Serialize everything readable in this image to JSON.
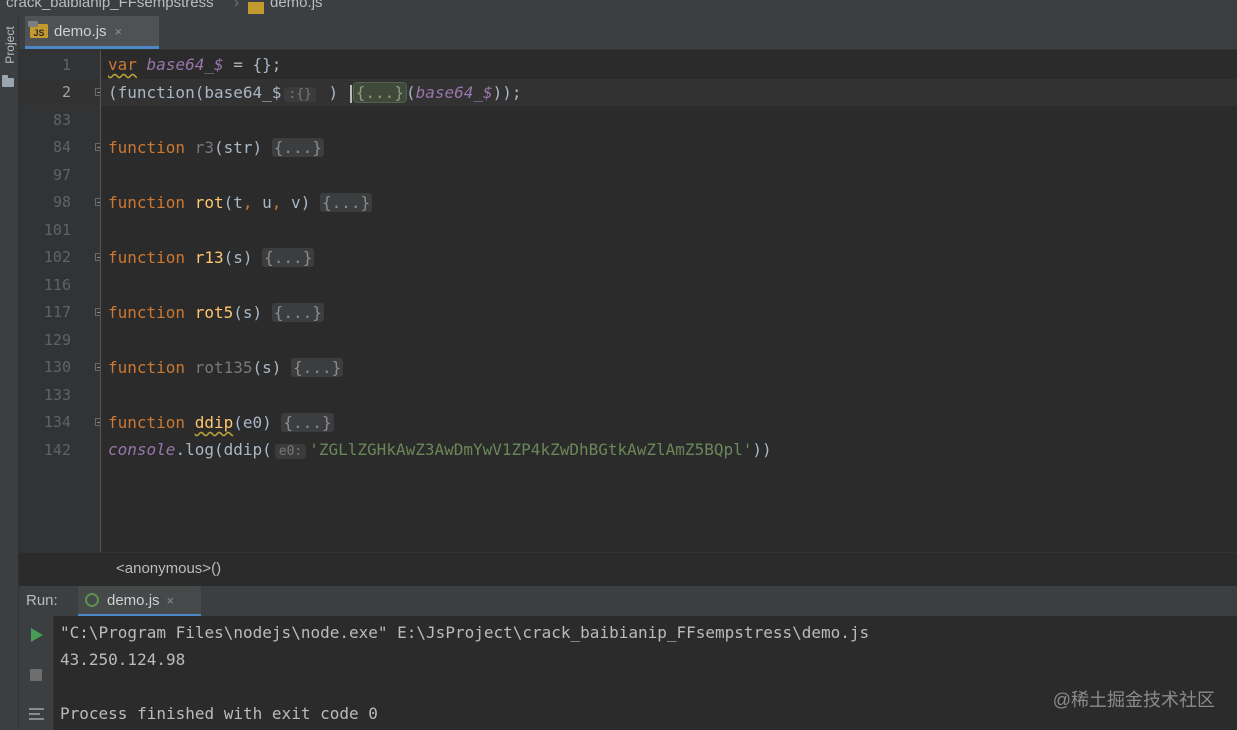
{
  "breadcrumb": {
    "project": "crack_baibianip_FFsempstress",
    "file": "demo.js"
  },
  "sidebar": {
    "project_label": "Project"
  },
  "editor_tab": {
    "label": "demo.js",
    "close": "×",
    "icon": "js-file-icon"
  },
  "editor": {
    "line_numbers": [
      "1",
      "2",
      "83",
      "84",
      "97",
      "98",
      "101",
      "102",
      "116",
      "117",
      "129",
      "130",
      "133",
      "134",
      "142"
    ],
    "line1": {
      "var": "var",
      "name": "base64_$",
      "rest": " = {};"
    },
    "line2": {
      "open": "(function(base64_$",
      "hint": ":{}",
      "mid": " ) ",
      "fold": "{...}",
      "paren": "(",
      "arg": "base64_$",
      "close": "));"
    },
    "functions": [
      {
        "kw": "function",
        "name": "r3",
        "params": "(str)",
        "fold": "{...}",
        "used": false
      },
      {
        "kw": "function",
        "name": "rot",
        "params_open": "(t",
        "comma1": ",",
        "u": " u",
        "comma2": ",",
        "v": " v)",
        "fold": "{...}",
        "used": true
      },
      {
        "kw": "function",
        "name": "r13",
        "params": "(s)",
        "fold": "{...}",
        "used": true
      },
      {
        "kw": "function",
        "name": "rot5",
        "params": "(s)",
        "fold": "{...}",
        "used": true
      },
      {
        "kw": "function",
        "name": "rot135",
        "params": "(s)",
        "fold": "{...}",
        "used": false
      },
      {
        "kw": "function",
        "name": "ddip",
        "params": "(e0)",
        "fold": "{...}",
        "used": true
      }
    ],
    "last_line": {
      "obj": "console",
      "dot": ".log(ddip(",
      "hint": "e0:",
      "arg": "'ZGLlZGHkAwZ3AwDmYwV1ZP4kZwDhBGtkAwZlAmZ5BQpl'",
      "close": "))"
    }
  },
  "editor_status": {
    "text": "<anonymous>()"
  },
  "run_panel": {
    "title": "Run:",
    "tab_label": "demo.js",
    "tab_close": "×",
    "output": [
      "\"C:\\Program Files\\nodejs\\node.exe\" E:\\JsProject\\crack_baibianip_FFsempstress\\demo.js",
      "43.250.124.98",
      "",
      "Process finished with exit code 0"
    ]
  },
  "watermark": "@稀土掘金技术社区"
}
